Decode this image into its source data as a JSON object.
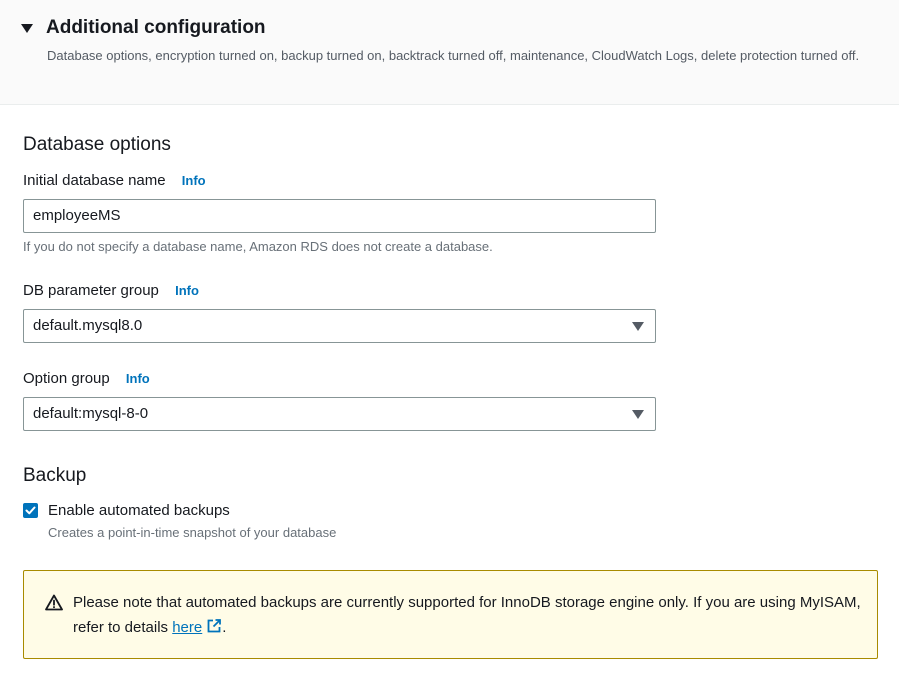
{
  "header": {
    "title": "Additional configuration",
    "description": "Database options, encryption turned on, backup turned on, backtrack turned off, maintenance, CloudWatch Logs, delete protection turned off."
  },
  "database_options": {
    "title": "Database options",
    "initial_db_name": {
      "label": "Initial database name",
      "info": "Info",
      "value": "employeeMS",
      "hint": "If you do not specify a database name, Amazon RDS does not create a database."
    },
    "db_parameter_group": {
      "label": "DB parameter group",
      "info": "Info",
      "value": "default.mysql8.0"
    },
    "option_group": {
      "label": "Option group",
      "info": "Info",
      "value": "default:mysql-8-0"
    }
  },
  "backup": {
    "title": "Backup",
    "enable_label": "Enable automated backups",
    "enable_checked": true,
    "enable_desc": "Creates a point-in-time snapshot of your database",
    "warning": {
      "text_before": "Please note that automated backups are currently supported for InnoDB storage engine only. If you are using MyISAM, refer to details ",
      "link": "here",
      "text_after": ".",
      "icon": "warning-icon"
    }
  },
  "colors": {
    "link": "#0073bb",
    "warning_bg": "#fffce7",
    "warning_border": "#a88b00"
  }
}
